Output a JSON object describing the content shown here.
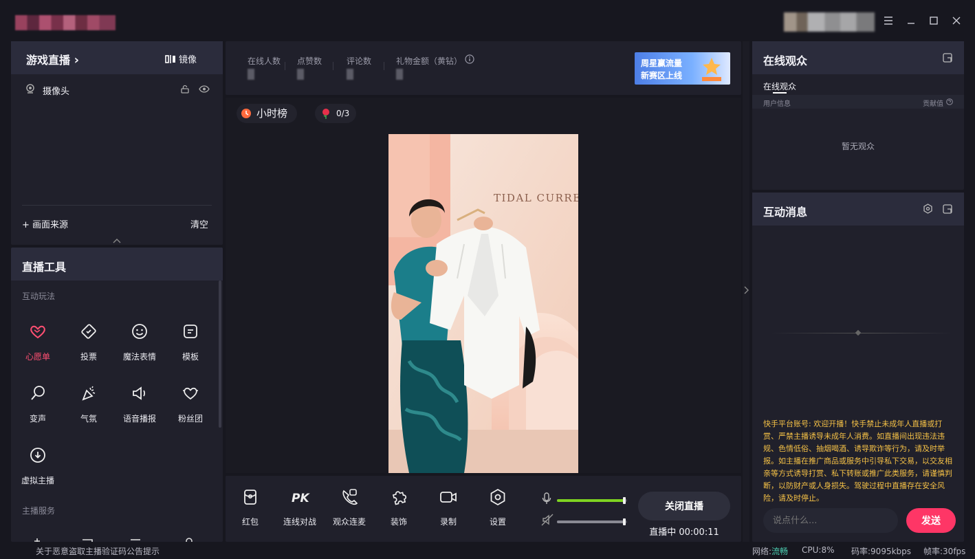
{
  "titlebar": {
    "menu_icon": "hamburger-icon",
    "minimize_icon": "minimize-icon",
    "maximize_icon": "maximize-icon",
    "close_icon": "close-icon"
  },
  "source_panel": {
    "title": "游戏直播",
    "title_arrow": "›",
    "mirror_label": "镜像",
    "sources": [
      {
        "label": "摄像头"
      }
    ],
    "add_source_label": "+ 画面来源",
    "clear_label": "清空",
    "collapse_icon": "chevron-up-icon"
  },
  "tools_panel": {
    "title": "直播工具",
    "section1": "互动玩法",
    "tools": [
      {
        "label": "心愿单",
        "icon": "heart-wish-icon",
        "active": true
      },
      {
        "label": "投票",
        "icon": "vote-icon"
      },
      {
        "label": "魔法表情",
        "icon": "smile-icon"
      },
      {
        "label": "模板",
        "icon": "template-icon"
      },
      {
        "label": "变声",
        "icon": "voice-change-icon"
      },
      {
        "label": "气氛",
        "icon": "party-icon"
      },
      {
        "label": "语音播报",
        "icon": "speaker-icon"
      },
      {
        "label": "粉丝团",
        "icon": "fan-heart-icon"
      },
      {
        "label": "虚拟主播",
        "icon": "download-circle-icon"
      }
    ],
    "section2": "主播服务"
  },
  "stats": {
    "items": [
      {
        "label": "在线人数"
      },
      {
        "label": "点赞数"
      },
      {
        "label": "评论数"
      },
      {
        "label": "礼物金额（黄钻）"
      }
    ],
    "info_icon": "info-icon",
    "banner": {
      "line1": "周星赢流量",
      "line2": "新赛区上线"
    }
  },
  "stage": {
    "hour_rank_label": "小时榜",
    "rose_count": "0/3",
    "wall_text": "TIDAL CURRENT"
  },
  "bottom_bar": {
    "tools": [
      {
        "label": "红包",
        "icon": "red-packet-icon"
      },
      {
        "label": "连线对战",
        "icon": "pk-icon"
      },
      {
        "label": "观众连麦",
        "icon": "call-icon"
      },
      {
        "label": "装饰",
        "icon": "puzzle-icon"
      },
      {
        "label": "录制",
        "icon": "record-icon"
      },
      {
        "label": "设置",
        "icon": "settings-icon"
      }
    ],
    "mic_level": 0.98,
    "speaker_level": 0.98,
    "end_live_label": "关闭直播",
    "live_status": "直播中 00:00:11"
  },
  "audience_panel": {
    "title": "在线观众",
    "tab": "在线观众",
    "col_user": "用户信息",
    "col_contrib": "贡献值",
    "empty_text": "暂无观众"
  },
  "message_panel": {
    "title": "互动消息",
    "notice": "快手平台账号: 欢迎开播！快手禁止未成年人直播或打赏、严禁主播诱导未成年人消费。如直播间出现违法违规、色情低俗、抽烟喝酒、诱导欺诈等行为，请及时举报。如主播在推广商品或服务中引导私下交易，以交友相亲等方式诱导打赏、私下转账或推广此类服务，请谨慎判断，以防财产或人身损失。驾驶过程中直播存在安全风险，请及时停止。",
    "input_placeholder": "说点什么...",
    "send_label": "发送"
  },
  "statusbar": {
    "notice": "关于恶意盗取主播验证码公告提示",
    "network_label": "网络:",
    "network_value": "流畅",
    "cpu": "CPU:8%",
    "bitrate": "码率:9095kbps",
    "fps": "帧率:30fps"
  },
  "colors": {
    "accent_pink": "#fe3666",
    "active_tool": "#ff4f72",
    "green_level": "#7ed321",
    "notice_text": "#f5c146",
    "network_ok": "#4ccfb2"
  }
}
